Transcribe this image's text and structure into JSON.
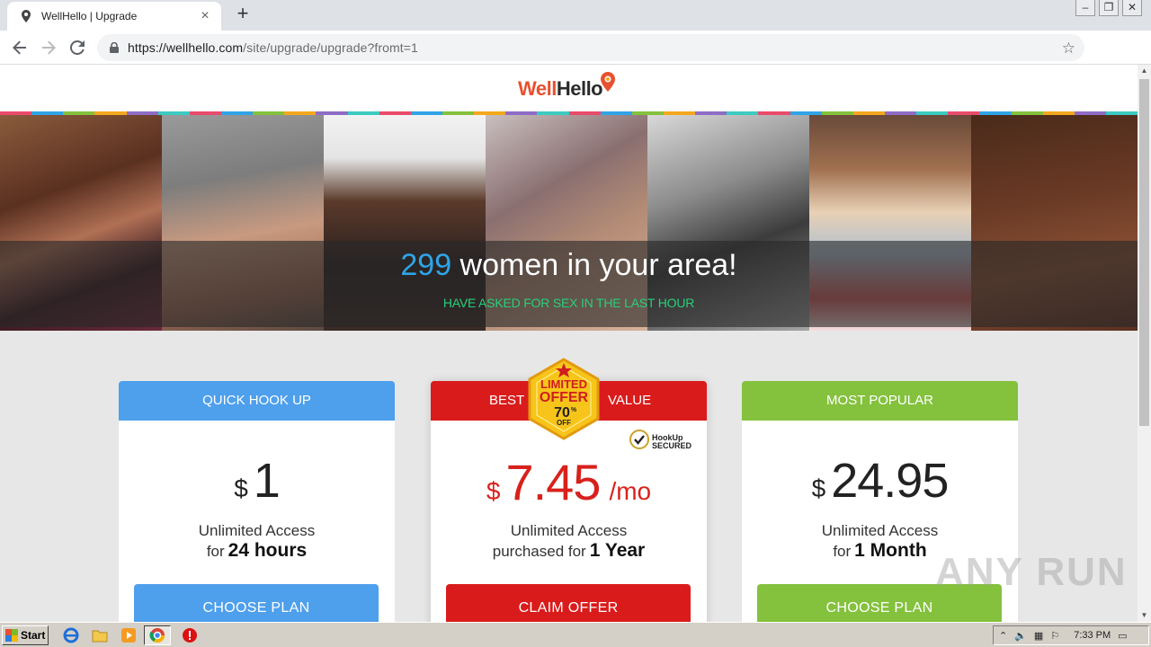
{
  "browser": {
    "tab_title": "WellHello | Upgrade",
    "tab_close": "×",
    "new_tab": "+",
    "url_host": "https://wellhello.com",
    "url_path": "/site/upgrade/upgrade?fromt=1",
    "window_buttons": [
      "–",
      "❐",
      "✕"
    ]
  },
  "site": {
    "logo_well": "Well",
    "logo_hello": "Hello",
    "hero_count": "299",
    "hero_title_rest": " women in your area!",
    "hero_subtitle": "HAVE ASKED FOR SEX IN THE LAST HOUR"
  },
  "plans": [
    {
      "header": "QUICK HOOK UP",
      "currency": "$",
      "amount": "1",
      "line1": "Unlimited Access",
      "line2_prefix": "for",
      "line2_bold": "24 hours",
      "cta": "CHOOSE PLAN"
    },
    {
      "header_left": "BEST",
      "header_right": "VALUE",
      "badge_line1": "LIMITED",
      "badge_line2": "OFFER",
      "badge_pct": "70",
      "badge_pct_sign": "%",
      "badge_off": "OFF",
      "secured_line1": "HookUp",
      "secured_line2": "SECURED",
      "currency": "$",
      "amount": "7.45",
      "per": "/mo",
      "line1": "Unlimited Access",
      "line2_prefix": "purchased for",
      "line2_bold": "1 Year",
      "cta": "CLAIM OFFER"
    },
    {
      "header": "MOST POPULAR",
      "currency": "$",
      "amount": "24.95",
      "line1": "Unlimited Access",
      "line2_prefix": "for",
      "line2_bold": "1 Month",
      "cta": "CHOOSE PLAN"
    }
  ],
  "watermark": "ANY RUN",
  "taskbar": {
    "start_label": "Start",
    "clock": "7:33 PM"
  },
  "colors": {
    "blue": "#4e9fec",
    "red": "#da1b1b",
    "green": "#84c13d",
    "hero_count": "#2fa4e7",
    "hero_sub": "#27d07a"
  }
}
